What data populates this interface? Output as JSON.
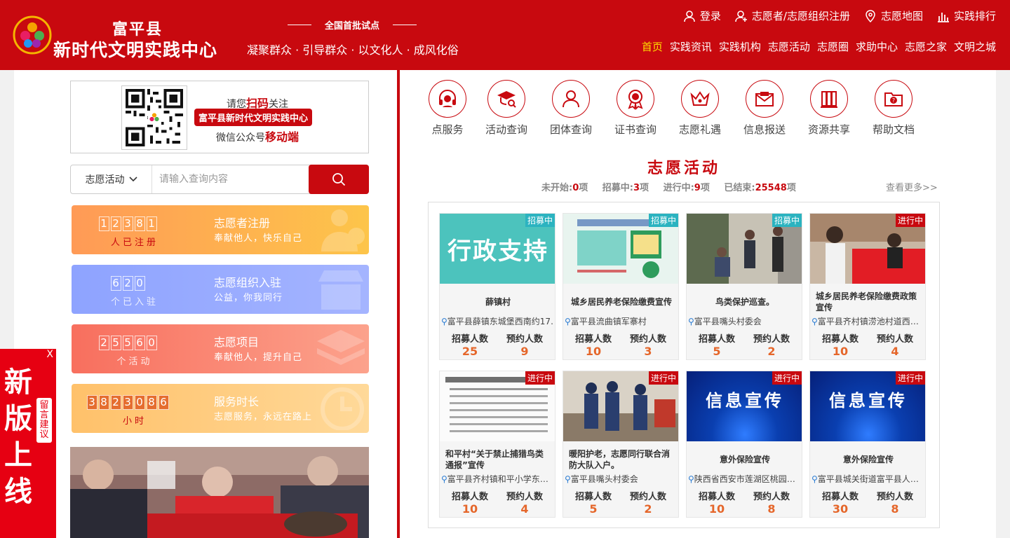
{
  "header": {
    "logo_line1": "富平县",
    "logo_line2": "新时代文明实践中心",
    "pilot": "全国首批试点",
    "slogan": "凝聚群众 · 引导群众 · 以文化人 · 成风化俗",
    "top_links": [
      "登录",
      "志愿者/志愿组织注册",
      "志愿地图",
      "实践排行"
    ],
    "nav": [
      "首页",
      "实践资讯",
      "实践机构",
      "志愿活动",
      "志愿圈",
      "求助中心",
      "志愿之家",
      "文明之城"
    ]
  },
  "qr": {
    "line1_a": "请您",
    "line1_b": "扫码",
    "line1_c": "关注",
    "badge": "富平县新时代文明实践中心",
    "line3_a": "微信公众号",
    "line3_b": "移动端"
  },
  "search": {
    "category": "志愿活动",
    "placeholder": "请输入查询内容"
  },
  "stats": [
    {
      "digits": [
        "1",
        "2",
        "3",
        "8",
        "1"
      ],
      "sub": "人已注册",
      "title": "志愿者注册",
      "desc": "奉献他人，快乐自己"
    },
    {
      "digits": [
        "6",
        "2",
        "0"
      ],
      "sub": "个已入驻",
      "title": "志愿组织入驻",
      "desc": "公益，你我同行"
    },
    {
      "digits": [
        "2",
        "5",
        "5",
        "6",
        "0"
      ],
      "sub": "个活动",
      "title": "志愿项目",
      "desc": "奉献他人，提升自己"
    },
    {
      "digits": [
        "3",
        "8",
        "2",
        "3",
        "0",
        "8",
        "6"
      ],
      "sub": "小时",
      "title": "服务时长",
      "desc": "志愿服务，永远在路上"
    }
  ],
  "float_ad": {
    "close": "X",
    "big": "新版上线",
    "vertical": "留言建议"
  },
  "services": [
    "点服务",
    "活动查询",
    "团体查询",
    "证书查询",
    "志愿礼遇",
    "信息报送",
    "资源共享",
    "帮助文档"
  ],
  "activities": {
    "title": "志愿活动",
    "not_started_label": "未开始:",
    "not_started": "0",
    "recruiting_label": "招募中:",
    "recruiting": "3",
    "ongoing_label": "进行中:",
    "ongoing": "9",
    "ended_label": "已结束:",
    "ended": "25548",
    "unit": "项",
    "more": "查看更多>>",
    "recruit_label": "招募人数",
    "reserve_label": "预约人数",
    "cards": [
      {
        "badge": "招募中",
        "title": "薛镇村",
        "location": "富平县薛镇东城堡西南约17.",
        "recruit": "25",
        "reserve": "9"
      },
      {
        "badge": "招募中",
        "title": "城乡居民养老保险缴费宣传",
        "location": "富平县流曲镇军寨村",
        "recruit": "10",
        "reserve": "3"
      },
      {
        "badge": "招募中",
        "title": "鸟类保护巡查。",
        "location": "富平县嘴头村委会",
        "recruit": "5",
        "reserve": "2"
      },
      {
        "badge": "进行中",
        "title": "城乡居民养老保险缴费政策宣传",
        "location": "富平县齐村镇涝池村道西南...",
        "recruit": "10",
        "reserve": "4"
      },
      {
        "badge": "进行中",
        "title": "和平村“关于禁止捕猎鸟类通报”宣传",
        "location": "富平县齐村镇和平小学东北...",
        "recruit": "10",
        "reserve": "4"
      },
      {
        "badge": "进行中",
        "title": "暖阳护老，志愿同行联合消防大队入户。",
        "location": "富平县嘴头村委会",
        "recruit": "5",
        "reserve": "2"
      },
      {
        "badge": "进行中",
        "title": "意外保险宣传",
        "location": "陕西省西安市莲湖区桃园路...",
        "recruit": "10",
        "reserve": "8"
      },
      {
        "badge": "进行中",
        "title": "意外保险宣传",
        "location": "富平县城关街道富平县人民...",
        "recruit": "30",
        "reserve": "8"
      }
    ],
    "image_texts": [
      "行政支持",
      "信息宣传",
      "信息宣传"
    ]
  }
}
